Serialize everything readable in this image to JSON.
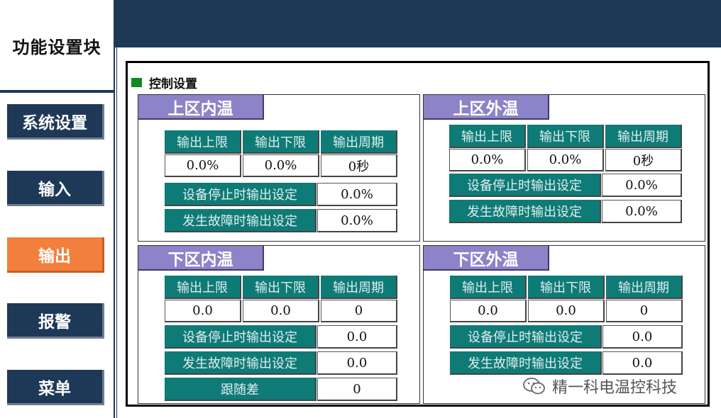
{
  "sidebar": {
    "title": "功能设置块",
    "items": [
      {
        "label": "系统设置"
      },
      {
        "label": "输入"
      },
      {
        "label": "输出"
      },
      {
        "label": "报警"
      },
      {
        "label": "菜单"
      }
    ],
    "active_index": 2
  },
  "main": {
    "section_title": "控制设置",
    "zones": [
      {
        "name": "上区内温",
        "headers": [
          "输出上限",
          "输出下限",
          "输出周期"
        ],
        "values": [
          "0.0%",
          "0.0%",
          "0秒"
        ],
        "stop_label": "设备停止时输出设定",
        "stop_value": "0.0%",
        "fault_label": "发生故障时输出设定",
        "fault_value": "0.0%"
      },
      {
        "name": "上区外温",
        "headers": [
          "输出上限",
          "输出下限",
          "输出周期"
        ],
        "values": [
          "0.0%",
          "0.0%",
          "0秒"
        ],
        "stop_label": "设备停止时输出设定",
        "stop_value": "0.0%",
        "fault_label": "发生故障时输出设定",
        "fault_value": "0.0%"
      },
      {
        "name": "下区内温",
        "headers": [
          "输出上限",
          "输出下限",
          "输出周期"
        ],
        "values": [
          "0.0",
          "0.0",
          "0"
        ],
        "stop_label": "设备停止时输出设定",
        "stop_value": "0.0",
        "fault_label": "发生故障时输出设定",
        "fault_value": "0.0",
        "follow_label": "跟随差",
        "follow_value": "0"
      },
      {
        "name": "下区外温",
        "headers": [
          "输出上限",
          "输出下限",
          "输出周期"
        ],
        "values": [
          "0.0",
          "0.0",
          "0"
        ],
        "stop_label": "设备停止时输出设定",
        "stop_value": "0.0",
        "fault_label": "发生故障时输出设定",
        "fault_value": "0.0"
      }
    ]
  },
  "watermark": {
    "text": "精一科电温控科技",
    "icon": "wechat-icon"
  },
  "colors": {
    "navy": "#1e3858",
    "active_orange": "#f2803c",
    "zone_label_purple": "#8c83c8",
    "cell_teal": "#0f7b77",
    "section_green": "#0e8a20"
  }
}
